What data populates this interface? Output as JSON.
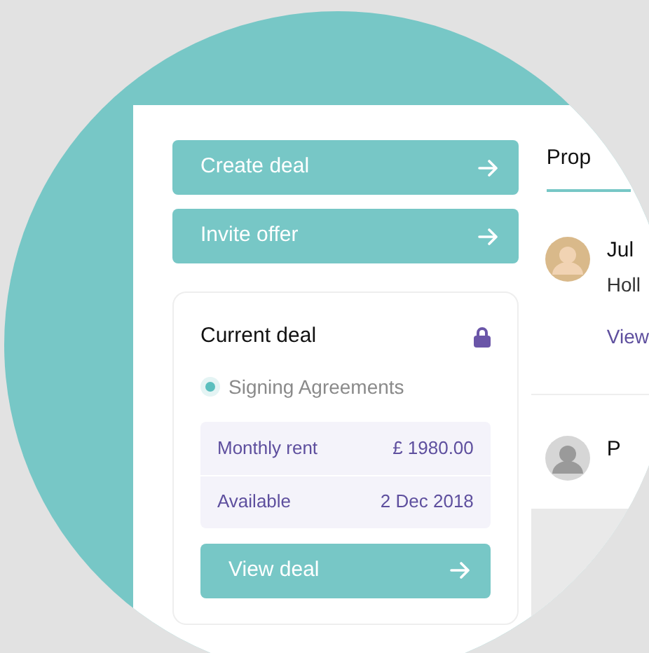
{
  "actions": [
    {
      "label": "Create deal"
    },
    {
      "label": "Invite offer"
    }
  ],
  "current_deal": {
    "title": "Current deal",
    "locked": true,
    "status": "Signing Agreements",
    "details": [
      {
        "label": "Monthly rent",
        "value": "£ 1980.00"
      },
      {
        "label": "Available",
        "value": "2 Dec 2018"
      }
    ],
    "button": "View deal"
  },
  "side_panel": {
    "tabs": [
      {
        "label": "Prop",
        "selected": true
      }
    ],
    "people": [
      {
        "name": "Jul",
        "subtitle": "Holl",
        "link": "View"
      },
      {
        "name": "P"
      }
    ]
  }
}
